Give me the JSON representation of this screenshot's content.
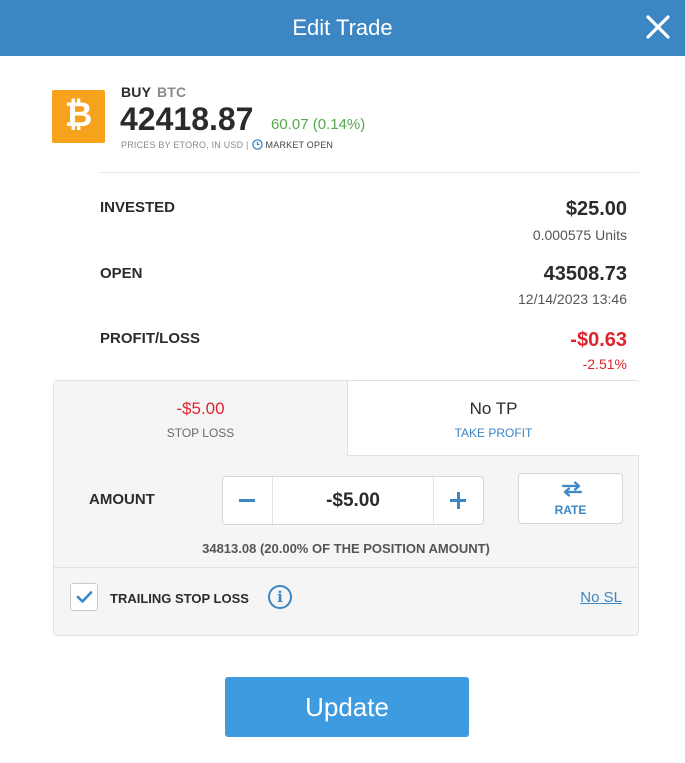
{
  "header": {
    "title": "Edit Trade",
    "close_icon": "close-icon"
  },
  "asset": {
    "icon": "bitcoin-icon",
    "logo_glyph": "₿",
    "action": "BUY",
    "symbol": "BTC",
    "price": "42418.87",
    "change": "60.07 (0.14%)",
    "prices_note": "PRICES BY ETORO, IN USD |",
    "market_status": "MARKET OPEN"
  },
  "summary": {
    "invested": {
      "label": "INVESTED",
      "value": "$25.00",
      "sub": "0.000575 Units"
    },
    "open": {
      "label": "OPEN",
      "value": "43508.73",
      "sub": "12/14/2023 13:46"
    },
    "profit_loss": {
      "label": "PROFIT/LOSS",
      "value": "-$0.63",
      "sub": "-2.51%"
    }
  },
  "tabs": {
    "stop_loss": {
      "value": "-$5.00",
      "label": "STOP LOSS"
    },
    "take_profit": {
      "value": "No TP",
      "label": "TAKE PROFIT"
    }
  },
  "amount": {
    "label": "AMOUNT",
    "value": "-$5.00",
    "rate_label": "RATE",
    "note": "34813.08 (20.00% OF THE POSITION AMOUNT)"
  },
  "trailing": {
    "label": "TRAILING STOP LOSS",
    "checked": true,
    "link": "No SL"
  },
  "footer": {
    "update_label": "Update"
  },
  "colors": {
    "header": "#3c86c4",
    "accent": "#3c86c4",
    "negative": "#e0242f",
    "positive": "#55a84e",
    "button": "#3f9be0",
    "btc": "#f7a21b"
  }
}
